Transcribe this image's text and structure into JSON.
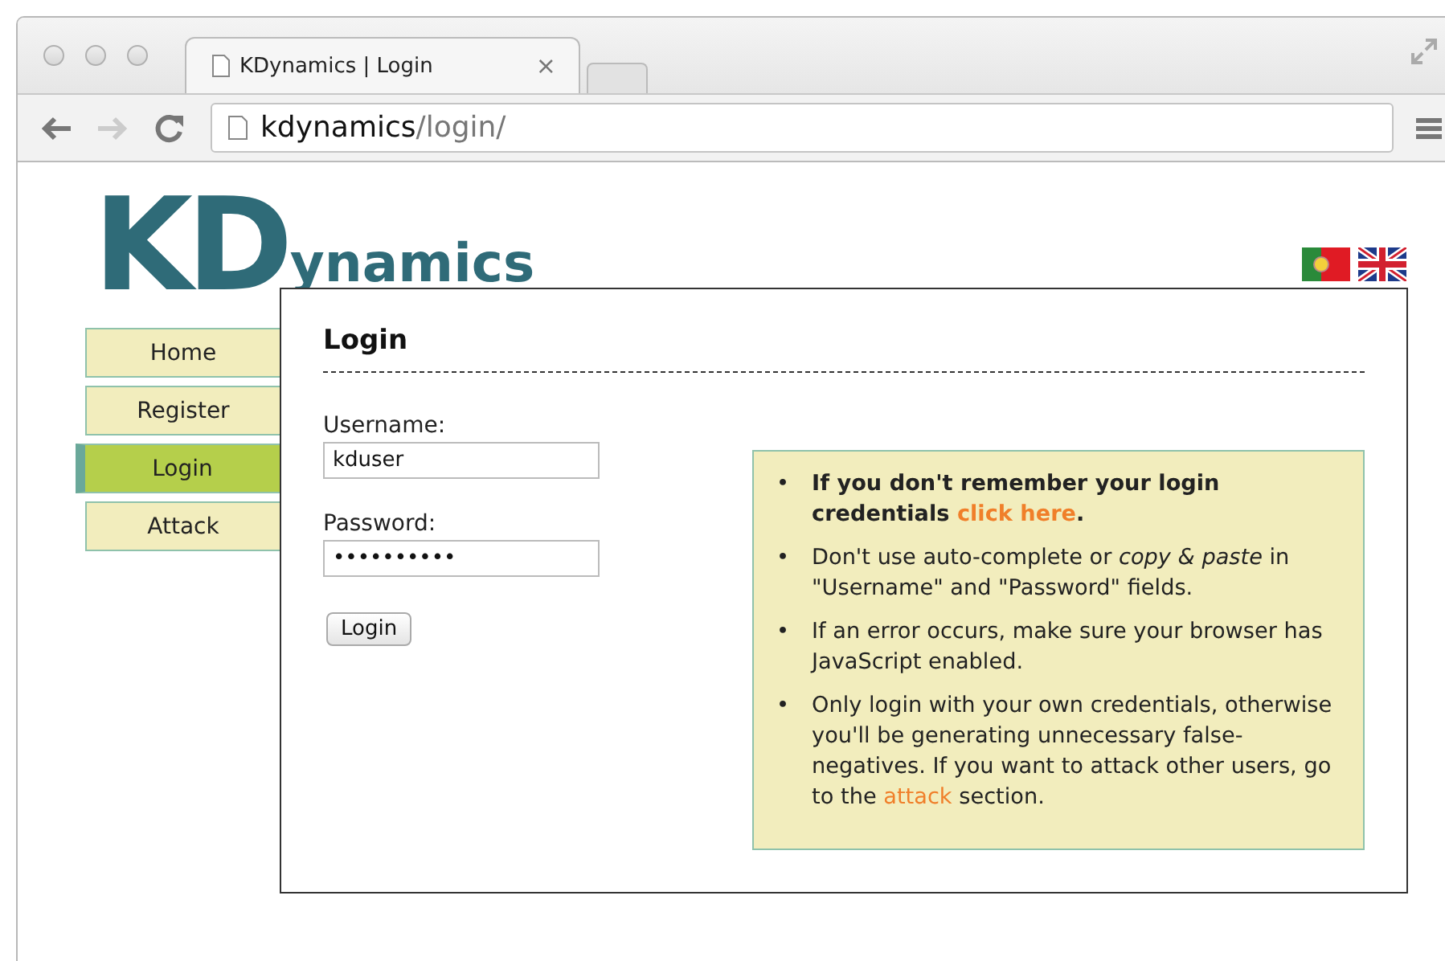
{
  "browser": {
    "tab_title": "KDynamics | Login",
    "tab_close": "×",
    "address": {
      "host": "kdynamics",
      "path": "/login/"
    }
  },
  "logo": {
    "initials": "KD",
    "rest": "ynamics"
  },
  "nav": [
    {
      "label": "Home",
      "selected": false
    },
    {
      "label": "Register",
      "selected": false
    },
    {
      "label": "Login",
      "selected": true
    },
    {
      "label": "Attack",
      "selected": false
    }
  ],
  "login": {
    "title": "Login",
    "username_label": "Username:",
    "username_value": "kduser",
    "password_label": "Password:",
    "password_value": "••••••••••",
    "button": "Login"
  },
  "tips": [
    {
      "bullet": "•",
      "bold": true,
      "parts": [
        {
          "kind": "text",
          "text": "If you don't remember your login credentials "
        },
        {
          "kind": "link",
          "text": "click here"
        },
        {
          "kind": "text",
          "text": "."
        }
      ]
    },
    {
      "bullet": "•",
      "bold": false,
      "parts": [
        {
          "kind": "text",
          "text": "Don't use auto-complete or "
        },
        {
          "kind": "italic",
          "text": "copy & paste"
        },
        {
          "kind": "text",
          "text": " in \"Username\" and \"Password\" fields."
        }
      ]
    },
    {
      "bullet": "•",
      "bold": false,
      "parts": [
        {
          "kind": "text",
          "text": "If an error occurs, make sure your browser has JavaScript enabled."
        }
      ]
    },
    {
      "bullet": "•",
      "bold": false,
      "parts": [
        {
          "kind": "text",
          "text": "Only login with your own credentials, otherwise you'll be generating unnecessary false-negatives. If you want to attack other users, go to the "
        },
        {
          "kind": "link",
          "text": "attack"
        },
        {
          "kind": "text",
          "text": " section."
        }
      ]
    }
  ]
}
